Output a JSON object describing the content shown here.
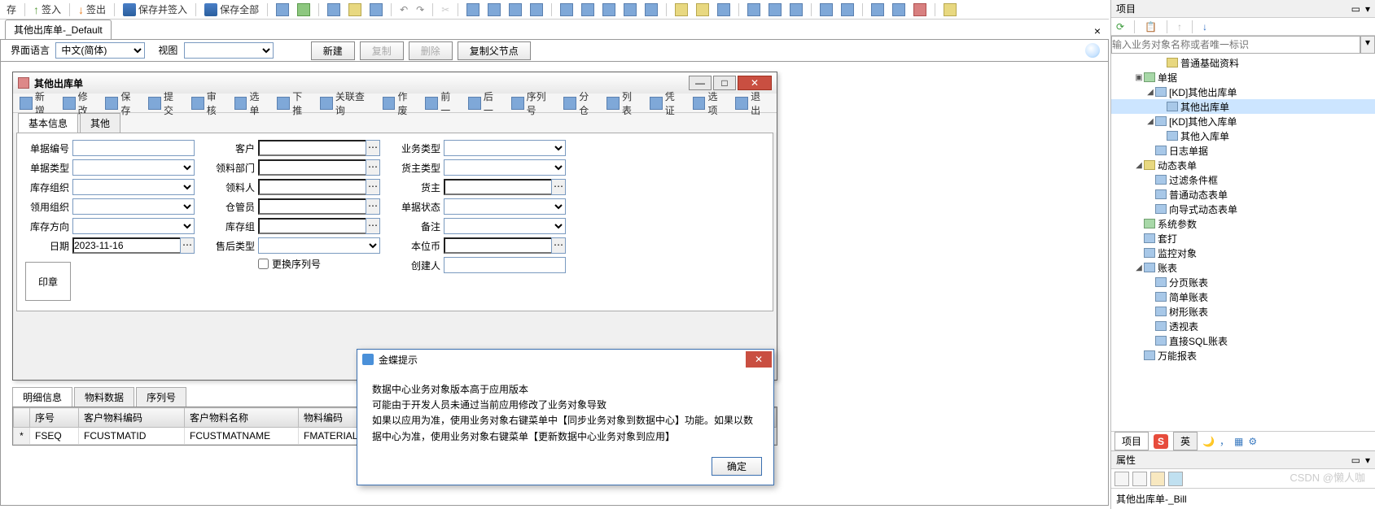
{
  "topToolbar": {
    "save": "存",
    "signIn": "签入",
    "signOut": "签出",
    "saveAndSignIn": "保存并签入",
    "saveAll": "保存全部"
  },
  "docTab": "其他出库单-_Default",
  "optionsBar": {
    "langLabel": "界面语言",
    "langValue": "中文(简体)",
    "viewLabel": "视图",
    "viewValue": "",
    "new": "新建",
    "copy": "复制",
    "delete": "删除",
    "copyParent": "复制父节点"
  },
  "innerWindow": {
    "title": "其他出库单",
    "toolbar": [
      "新增",
      "修改",
      "保存",
      "提交",
      "审核",
      "选单",
      "下推",
      "关联查询",
      "作废",
      "前一",
      "后一",
      "序列号",
      "分仓",
      "列表",
      "凭证",
      "选项",
      "退出"
    ],
    "tabs": [
      "基本信息",
      "其他"
    ],
    "col1Labels": [
      "单据编号",
      "单据类型",
      "库存组织",
      "领用组织",
      "库存方向",
      "日期"
    ],
    "col1Date": "2023-11-16",
    "stamp": "印章",
    "col2Labels": [
      "客户",
      "领料部门",
      "领料人",
      "仓管员",
      "库存组",
      "售后类型"
    ],
    "replaceSeq": "更换序列号",
    "col3Labels": [
      "业务类型",
      "货主类型",
      "货主",
      "单据状态",
      "备注",
      "本位币",
      "创建人"
    ]
  },
  "detail": {
    "tabs": [
      "明细信息",
      "物料数据",
      "序列号"
    ],
    "headers": [
      "序号",
      "客户物料编码",
      "客户物料名称",
      "物料编码"
    ],
    "row": [
      "FSEQ",
      "FCUSTMATID",
      "FCUSTMATNAME",
      "FMATERIALID"
    ]
  },
  "dialog": {
    "title": "金蝶提示",
    "line1": "数据中心业务对象版本高于应用版本",
    "line2": "可能由于开发人员未通过当前应用修改了业务对象导致",
    "line3": "如果以应用为准，使用业务对象右键菜单中【同步业务对象到数据中心】功能。如果以数据中心为准，使用业务对象右键菜单【更新数据中心业务对象到应用】",
    "ok": "确定"
  },
  "rightPanel": {
    "projectTitle": "项目",
    "searchPlaceholder": "输入业务对象名称或者唯一标识",
    "tree": [
      {
        "l": 4,
        "t": "",
        "i": "y",
        "txt": "普通基础资料"
      },
      {
        "l": 2,
        "t": "▣",
        "i": "g",
        "txt": "单据"
      },
      {
        "l": 3,
        "t": "◢",
        "i": "b",
        "txt": "[KD]其他出库单"
      },
      {
        "l": 4,
        "t": "",
        "i": "b",
        "txt": "其他出库单",
        "sel": true
      },
      {
        "l": 3,
        "t": "◢",
        "i": "b",
        "txt": "[KD]其他入库单"
      },
      {
        "l": 4,
        "t": "",
        "i": "b",
        "txt": "其他入库单"
      },
      {
        "l": 3,
        "t": "",
        "i": "b",
        "txt": "日志单据"
      },
      {
        "l": 2,
        "t": "◢",
        "i": "y",
        "txt": "动态表单"
      },
      {
        "l": 3,
        "t": "",
        "i": "b",
        "txt": "过滤条件框"
      },
      {
        "l": 3,
        "t": "",
        "i": "b",
        "txt": "普通动态表单"
      },
      {
        "l": 3,
        "t": "",
        "i": "b",
        "txt": "向导式动态表单"
      },
      {
        "l": 2,
        "t": "",
        "i": "g",
        "txt": "系统参数"
      },
      {
        "l": 2,
        "t": "",
        "i": "b",
        "txt": "套打"
      },
      {
        "l": 2,
        "t": "",
        "i": "b",
        "txt": "监控对象"
      },
      {
        "l": 2,
        "t": "◢",
        "i": "b",
        "txt": "账表"
      },
      {
        "l": 3,
        "t": "",
        "i": "b",
        "txt": "分页账表"
      },
      {
        "l": 3,
        "t": "",
        "i": "b",
        "txt": "简单账表"
      },
      {
        "l": 3,
        "t": "",
        "i": "b",
        "txt": "树形账表"
      },
      {
        "l": 3,
        "t": "",
        "i": "b",
        "txt": "透视表"
      },
      {
        "l": 3,
        "t": "",
        "i": "b",
        "txt": "直接SQL账表"
      },
      {
        "l": 2,
        "t": "",
        "i": "b",
        "txt": "万能报表"
      }
    ],
    "bottomTabs": [
      "项目",
      "英"
    ],
    "propTitle": "属性",
    "propValue": "其他出库单-_Bill"
  },
  "watermark": "CSDN @懒人咖"
}
